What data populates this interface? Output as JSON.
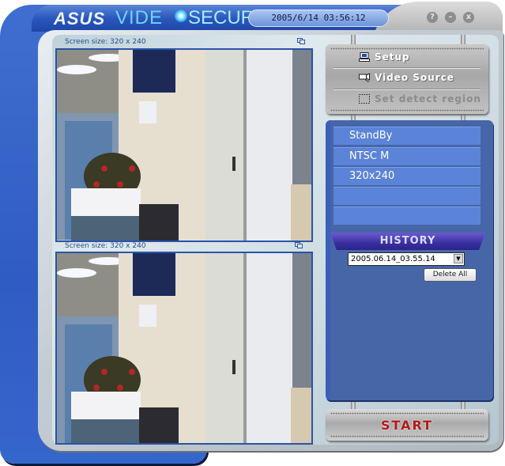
{
  "app": {
    "brand": "ASUS",
    "title_part1": "VIDE",
    "title_part2": "SECURITY",
    "datetime": "2005/6/14   03:56:12",
    "window_buttons": {
      "help": "?",
      "minimize": "–",
      "close": "x"
    }
  },
  "video_panes": [
    {
      "caption": "Screen size: 320 x 240",
      "expand_icon": "restore-window-icon"
    },
    {
      "caption": "Screen size: 320 x 240",
      "expand_icon": "restore-window-icon"
    }
  ],
  "menu": {
    "items": [
      {
        "label": "Setup",
        "icon": "computer-icon",
        "enabled": true
      },
      {
        "label": "Video Source",
        "icon": "camera-icon",
        "enabled": true
      },
      {
        "label": "Set detect region",
        "icon": "dashed-rect-icon",
        "enabled": false
      }
    ]
  },
  "status": {
    "rows": [
      "StandBy",
      "NTSC M",
      "320x240",
      "",
      ""
    ]
  },
  "history": {
    "title": "HISTORY",
    "selected": "2005.06.14_03.55.14",
    "delete_all_label": "Delete All"
  },
  "start_label": "START",
  "colors": {
    "shell_blue": "#2f5cc1",
    "panel_blue": "#4766a8",
    "row_blue": "#5b83d8",
    "history_purple": "#3a2fa0",
    "start_red": "#b21a1a"
  }
}
